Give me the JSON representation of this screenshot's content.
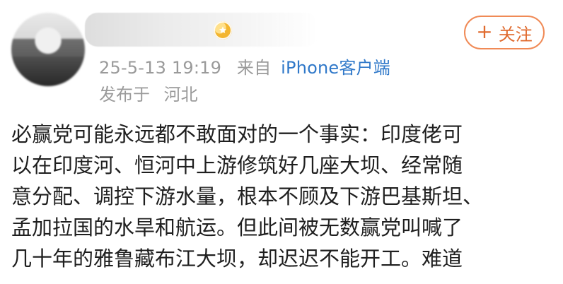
{
  "post": {
    "timestamp": "25-5-13 19:19",
    "via_label": "来自",
    "client": "iPhone客户端",
    "location_label": "发布于",
    "location": "河北",
    "follow_label": "关注",
    "content_lines": [
      "必赢党可能永远都不敢面对的一个事实：印度佬可",
      "以在印度河、恒河中上游修筑好几座大坝、经常随",
      "意分配、调控下游水量，根本不顾及下游巴基斯坦、",
      "孟加拉国的水旱和航运。但此间被无数赢党叫喊了",
      "几十年的雅鲁藏布江大坝，却迟迟不能开工。难道"
    ]
  },
  "icons": {
    "avatar": "avatar",
    "badge": "vip-badge-icon",
    "follow": "plus-icon"
  }
}
